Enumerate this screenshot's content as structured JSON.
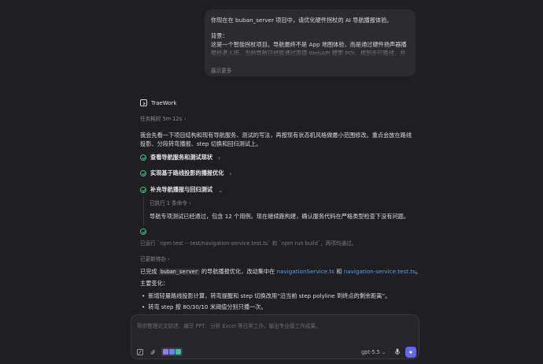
{
  "user_message": {
    "title": "你现在在 buban_server 项目中，请优化硬件拐杖的 AI 导航播报体验。",
    "body": "背景：\n这是一个智能拐杖项目。导航最终不是 App 地图体验，而是通过硬件扬声器播报给老人听。当前导航已经能通过高德 WebAPI 搜索 POI、规划步行路线，并基于设备 GPS telemetry 持续判断位置。核心代码在 src/services/navigationService.ts，相关测试在 test/nav",
    "show_more": "展示更多"
  },
  "agent": {
    "name": "TraeWork",
    "icon": "terminal-icon"
  },
  "duration": "任务耗时 5m 12s",
  "intro": "我会先看一下项目结构和现有导航服务、测试的写法，再按现有状态机风格做最小范围修改。重点会放在路线投影、分段转弯播报、step 切换和回归测试上。",
  "steps": [
    {
      "label": "查看导航服务和测试现状",
      "chevron": "›"
    },
    {
      "label": "实现基于路线投影的播报优化",
      "chevron": "›"
    },
    {
      "label": "补充导航播报与回归测试",
      "chevron": "⌄"
    }
  ],
  "executed": "已执行 1 条命令",
  "executed_chevron": "›",
  "subtext": "导航专项测试已经通过，包含 12 个用例。现在继续跑构建，确认服务代码在严格类型检查下没有问题。",
  "ran": "已运行 `npm test -- test/navigation-service.test.ts` 和 `npm run build`，两项均通过。",
  "updated": "已更新待办",
  "updated_chevron": "›",
  "done": {
    "prefix": "已完成",
    "project": "buban_server",
    "middle": "的导航播报优化，改动集中在",
    "file1": "navigationService.ts",
    "and": "和",
    "file2": "navigation-service.test.ts",
    "suffix": "。"
  },
  "changes_title": "主要变化：",
  "bullets": [
    "新增轻量路线投影计算，转弯提醒和 step 切换改用“沿当前 step polyline 到终点的剩余距离”。",
    "转弯 step 按 80/30/10 米阈值分别只播一次。"
  ],
  "composer": {
    "placeholder": "帮你整理论文综述、编写 PPT、分析 Excel 等日常工作，输出专业级工作成果。",
    "model": "gpt-5.5",
    "model_chevron": "⌄",
    "send_symbol": "✦"
  },
  "colors": {
    "accent": "#6366f1",
    "link": "#5b9cf5",
    "success": "#3fbf7f"
  }
}
